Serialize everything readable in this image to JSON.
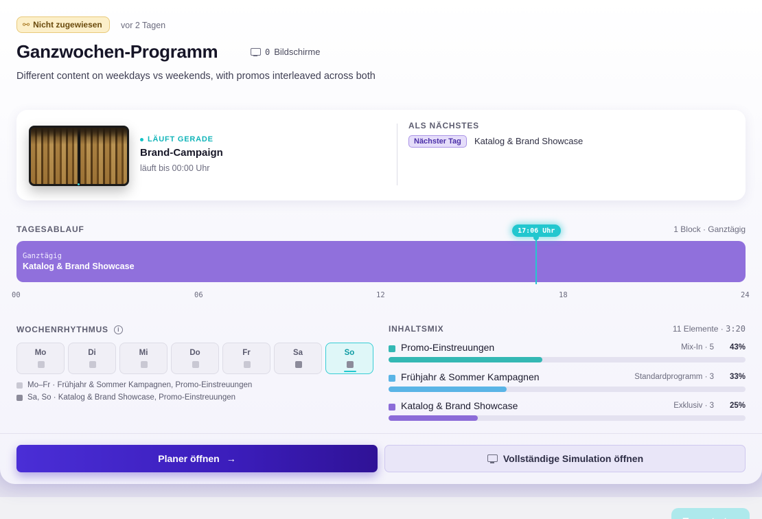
{
  "header": {
    "status_badge": "Nicht zugewiesen",
    "time_ago": "vor 2 Tagen",
    "title": "Ganzwochen-Programm",
    "screens_count": "0",
    "screens_label": "Bildschirme",
    "description": "Different content on weekdays vs weekends, with promos interleaved across both"
  },
  "now_playing": {
    "live_label": "LÄUFT GERADE",
    "title": "Brand-Campaign",
    "until": "läuft bis 00:00 Uhr",
    "next_label": "ALS NÄCHSTES",
    "next_tag": "Nächster Tag",
    "next_title": "Katalog & Brand Showcase"
  },
  "timeline": {
    "label": "TAGESABLAUF",
    "meta": "1 Block · Ganztägig",
    "block_sub": "Ganztägig",
    "block_title": "Katalog & Brand Showcase",
    "now_time": "17:06 Uhr",
    "now_fraction": 0.7125,
    "ticks": [
      "00",
      "06",
      "12",
      "18",
      "24"
    ],
    "color": "#9070dc"
  },
  "week": {
    "label": "WOCHENRHYTHMUS",
    "days": [
      "Mo",
      "Di",
      "Mi",
      "Do",
      "Fr",
      "Sa",
      "So"
    ],
    "active_day": "So",
    "legend": [
      {
        "text": "Mo–Fr · Frühjahr & Sommer Kampagnen, Promo-Einstreuungen",
        "color": "#c9c8d3"
      },
      {
        "text": "Sa, So · Katalog & Brand Showcase, Promo-Einstreuungen",
        "color": "#8c8b9a"
      }
    ]
  },
  "mix": {
    "label": "INHALTSMIX",
    "meta_count": "11 Elemente ·",
    "meta_duration": "3:20",
    "items": [
      {
        "name": "Promo-Einstreuungen",
        "kind": "Mix-In · 5",
        "percent": "43%",
        "share": 0.43,
        "color": "#34b8b4"
      },
      {
        "name": "Frühjahr & Sommer Kampagnen",
        "kind": "Standardprogramm · 3",
        "percent": "33%",
        "share": 0.33,
        "color": "#5ab4e6"
      },
      {
        "name": "Katalog & Brand Showcase",
        "kind": "Exklusiv · 3",
        "percent": "25%",
        "share": 0.25,
        "color": "#8c6cd8"
      }
    ]
  },
  "actions": {
    "primary": "Planer öffnen",
    "secondary": "Vollständige Simulation öffnen",
    "tour": "Tour starten"
  }
}
